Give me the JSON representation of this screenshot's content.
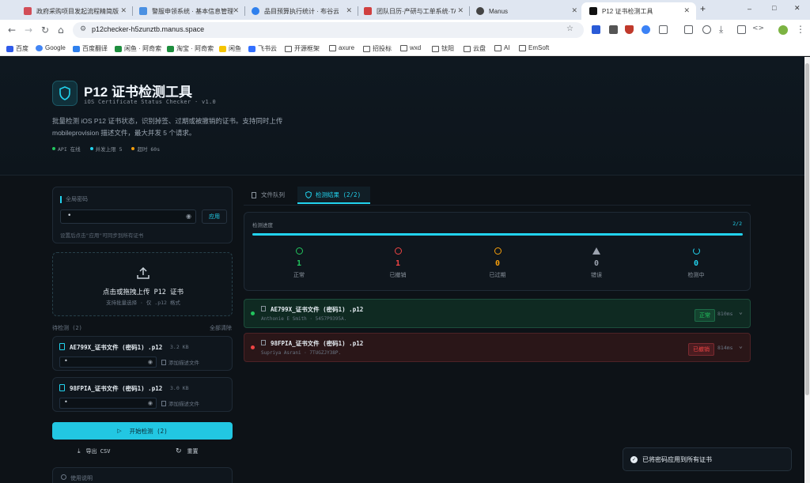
{
  "browser": {
    "tabs": [
      {
        "title": "政府采购项目发起流程精简版",
        "color": "#d24d57"
      },
      {
        "title": "警服申领系统 · 基本信息管理",
        "color": "#4a90e2"
      },
      {
        "title": "品目预算执行统计 · 布谷云报表",
        "color": "#2f80ed"
      },
      {
        "title": "团队日历·产研与工单系统·TAP",
        "color": "#d04040"
      },
      {
        "title": "Manus",
        "color": "#444444"
      },
      {
        "title": "P12 证书检测工具",
        "color": "#111111"
      }
    ],
    "new_tab": "+",
    "url": "p12checker-h5zunztb.manus.space",
    "bookmarks": [
      "百度",
      "Google",
      "百度翻译",
      "闲鱼 · 阿奇索",
      "淘宝 · 阿奇索",
      "闲鱼",
      "飞书云",
      "开源框架",
      "axure",
      "招投标",
      "wxd",
      "钛阳",
      "云盘",
      "AI",
      "EmSoft"
    ],
    "window_controls": [
      "–",
      "□",
      "✕"
    ]
  },
  "header": {
    "app_title": "P12 证书检测工具",
    "subtitle": "iOS Certificate Status Checker · v1.0",
    "description_line1": "批量检测 iOS P12 证书状态，识别掉签、过期或被撤销的证书。支持同时上传",
    "description_line2": "mobileprovision 描述文件，最大并发 5 个请求。",
    "status_items": [
      {
        "text": "API 在线",
        "color": "#22c55e"
      },
      {
        "text": "并发上限 5",
        "color": "#22d3ee"
      },
      {
        "text": "超时 60s",
        "color": "#f59e0b"
      }
    ]
  },
  "global_password": {
    "label": "全局密码",
    "value": "•",
    "apply_label": "应用",
    "hint": "设置后点击\"应用\"可同步到所有证书"
  },
  "upload": {
    "title": "点击或拖拽上传 P12 证书",
    "hint": "支持批量选择 · 仅 .p12 格式"
  },
  "queue": {
    "label": "待检测 (2)",
    "clear_label": "全部清除",
    "files": [
      {
        "name": "AE799X_证书文件 (密码1) .p12",
        "size": "3.2 KB",
        "password": "•",
        "desc_label": "添加描述文件"
      },
      {
        "name": "98FPIA_证书文件 (密码1) .p12",
        "size": "3.0 KB",
        "password": "•",
        "desc_label": "添加描述文件"
      }
    ]
  },
  "actions": {
    "start_label": "开始检测 (2)",
    "export_label": "导出 CSV",
    "reset_label": "重置"
  },
  "usage": {
    "label": "使用说明"
  },
  "tabs": {
    "file_queue": "文件队列",
    "results": "检测结果 (2/2)"
  },
  "progress": {
    "label": "检测进度",
    "count": "2/2",
    "fraction": 1.0
  },
  "stats": [
    {
      "label": "正常",
      "value": "1",
      "color": "#22c55e",
      "icon": "check-circle-icon"
    },
    {
      "label": "已撤销",
      "value": "1",
      "color": "#ef4444",
      "icon": "x-circle-icon"
    },
    {
      "label": "已过期",
      "value": "0",
      "color": "#f59e0b",
      "icon": "clock-icon"
    },
    {
      "label": "错误",
      "value": "0",
      "color": "#9ca3af",
      "icon": "warning-icon"
    },
    {
      "label": "检测中",
      "value": "0",
      "color": "#22d3ee",
      "icon": "loading-icon"
    }
  ],
  "results": [
    {
      "name": "AE799X_证书文件 (密码1) .p12",
      "owner": "Anthonie E Smith · 5457P9395A.",
      "status": "正常",
      "time": "810ms",
      "dot": "#22c55e",
      "status_color": "#22c55e"
    },
    {
      "name": "98FPIA_证书文件 (密码1) .p12",
      "owner": "Supriya Asrani · 7TUGZJY38P.",
      "status": "已撤销",
      "time": "814ms",
      "dot": "#ef4444",
      "status_color": "#ef4444"
    }
  ],
  "toast": {
    "text": "已将密码应用到所有证书"
  }
}
